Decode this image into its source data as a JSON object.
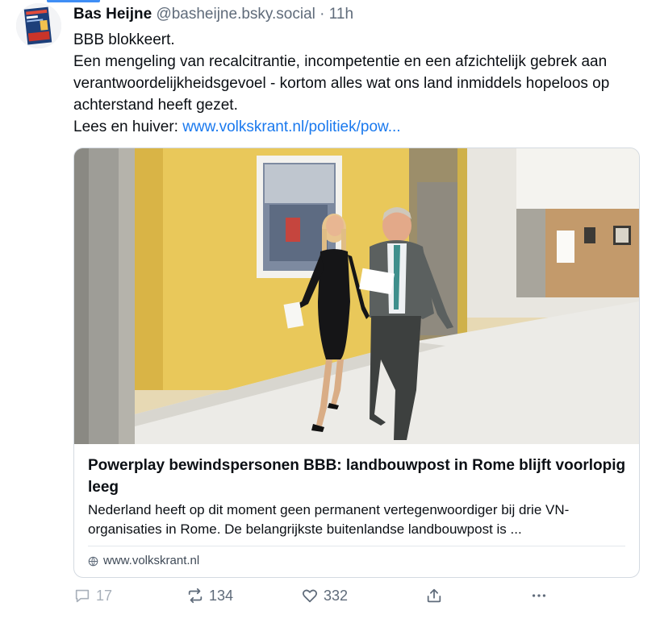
{
  "post": {
    "author_name": "Bas Heijne",
    "handle": "@basheijne.bsky.social",
    "separator": "·",
    "time": "11h",
    "lines": [
      "BBB blokkeert.",
      "Een mengeling van recalcitrantie, incompetentie en een afzichtelijk gebrek aan verantwoordelijkheidsgevoel - kortom alles wat ons land inmiddels hopeloos op achterstand heeft gezet."
    ],
    "link_prefix": "Lees en huiver: ",
    "link_text": "www.volkskrant.nl/politiek/pow..."
  },
  "card": {
    "title": "Powerplay bewindspersonen BBB: landbouwpost in Rome blijft voorlopig leeg",
    "description": "Nederland heeft op dit moment geen permanent vertegenwoordiger bij drie VN-organisaties in Rome. De belangrijkste buitenlandse landbouwpost is ...",
    "domain": "www.volkskrant.nl"
  },
  "actions": {
    "replies": "17",
    "reposts": "134",
    "likes": "332"
  },
  "colors": {
    "link": "#1a79ee",
    "muted": "#5f6b7a",
    "wall_yellow": "#e9c85a",
    "accent_bar": "#3f8ef5"
  },
  "icons": [
    "reply-icon",
    "repost-icon",
    "like-icon",
    "share-icon",
    "more-icon",
    "globe-icon"
  ]
}
